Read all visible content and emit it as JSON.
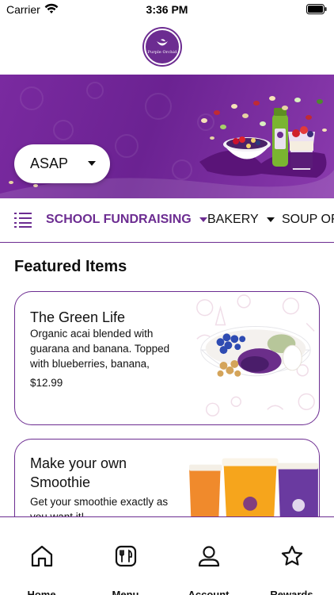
{
  "status_bar": {
    "carrier": "Carrier",
    "time": "3:36 PM"
  },
  "brand": {
    "logo_text": "Purple Orchid",
    "accent_color": "#6c2c91"
  },
  "hero": {
    "fulfillment_time": "ASAP"
  },
  "categories": [
    {
      "label": "SCHOOL FUNDRAISING",
      "active": true
    },
    {
      "label": "BAKERY",
      "active": false
    },
    {
      "label": "SOUP OF",
      "active": false
    }
  ],
  "featured": {
    "title": "Featured Items",
    "items": [
      {
        "name": "The Green Life",
        "description": "Organic acai blended with guarana and banana. Topped with blueberries, banana, hem…",
        "price": "$12.99",
        "image_icon": "acai-bowl-icon"
      },
      {
        "name": "Make your own Smoothie",
        "description": "Get your smoothie exactly as you want it!",
        "price": "",
        "image_icon": "smoothie-cups-icon"
      }
    ]
  },
  "nav": [
    {
      "label": "Home",
      "icon": "home-icon"
    },
    {
      "label": "Menu",
      "icon": "menu-icon"
    },
    {
      "label": "Account",
      "icon": "account-icon"
    },
    {
      "label": "Rewards",
      "icon": "rewards-icon"
    }
  ]
}
